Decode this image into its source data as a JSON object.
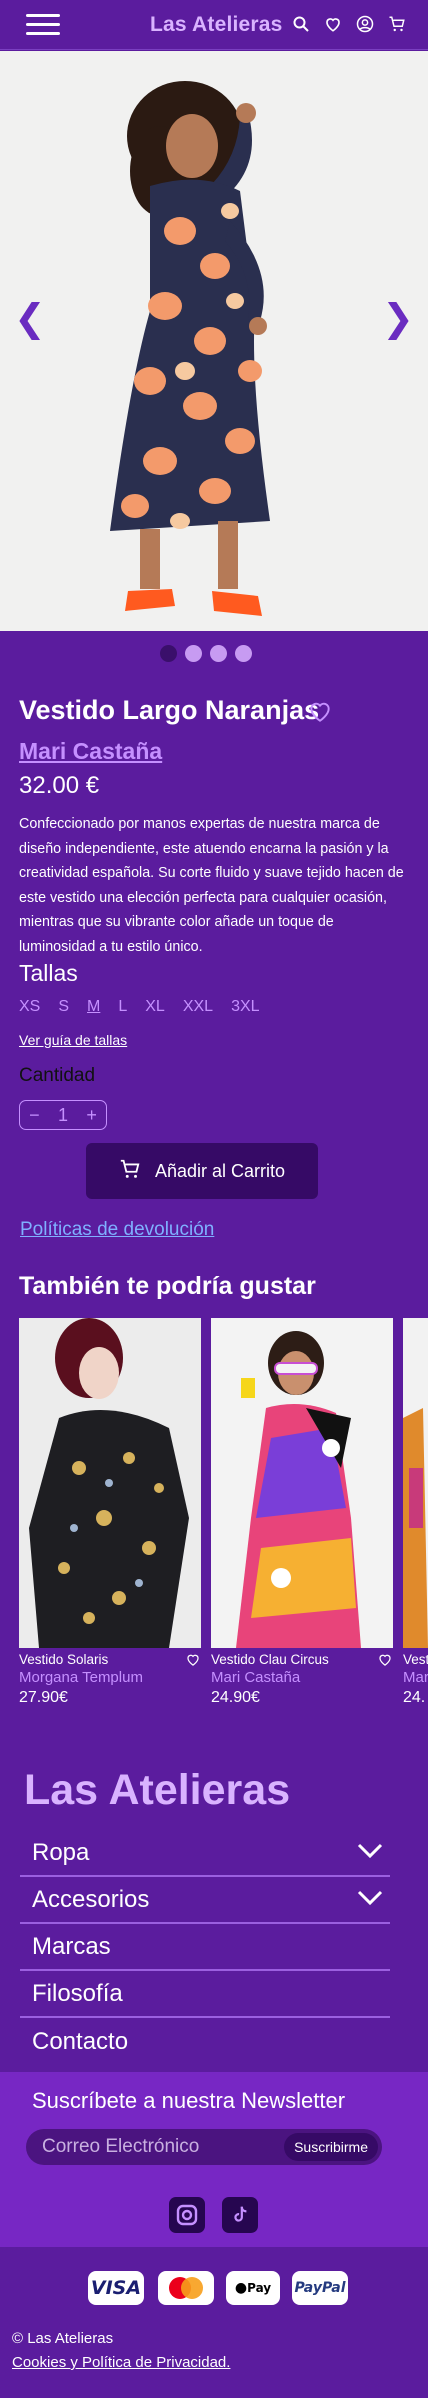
{
  "header": {
    "brand": "Las Atelieras",
    "icons": [
      "menu-icon",
      "search-icon",
      "heart-icon",
      "user-icon",
      "cart-icon"
    ]
  },
  "carousel": {
    "prev_icon": "❮",
    "next_icon": "❯",
    "slides": 4,
    "active": 0
  },
  "product": {
    "title": "Vestido Largo Naranjas",
    "designer": "Mari Castaña",
    "price": "32.00 €",
    "description": "Confeccionado por manos expertas de nuestra marca de diseño independiente, este atuendo encarna la pasión y la creatividad española. Su corte fluido y suave tejido hacen de este vestido una elección perfecta para cualquier ocasión, mientras que su vibrante color añade un toque de luminosidad a tu estilo único.",
    "sizes_title": "Tallas",
    "sizes": [
      "XS",
      "S",
      "M",
      "L",
      "XL",
      "XXL",
      "3XL"
    ],
    "selected_size": "M",
    "size_guide": "Ver guía de tallas",
    "quantity_title": "Cantidad",
    "quantity": "1",
    "minus": "−",
    "plus": "+",
    "add_to_cart": "Añadir al Carrito",
    "returns": "Políticas de devolución"
  },
  "recommendations": {
    "title": "También te podría gustar",
    "items": [
      {
        "name": "Vestido Solaris",
        "designer": "Morgana Templum",
        "price": "27.90€"
      },
      {
        "name": "Vestido Clau Circus",
        "designer": "Mari Castaña",
        "price": "24.90€"
      },
      {
        "name": "Vest",
        "designer": "Mar",
        "price": "24."
      }
    ]
  },
  "footer": {
    "logo": "Las Atelieras",
    "menu": [
      "Ropa",
      "Accesorios",
      "Marcas",
      "Filosofía",
      "Contacto"
    ],
    "newsletter_title": "Suscríbete a nuestra Newsletter",
    "email_placeholder": "Correo Electrónico",
    "subscribe": "Suscribirme",
    "payments": [
      "VISA",
      "Mastercard",
      "Pay",
      "PayPal"
    ],
    "copyright": "© Las Atelieras",
    "privacy": "Cookies y Política de Privacidad."
  },
  "colors": {
    "background": "#5b1c9e",
    "accent": "#c590ff",
    "dark": "#360a66",
    "newsletter": "#7727c4"
  }
}
